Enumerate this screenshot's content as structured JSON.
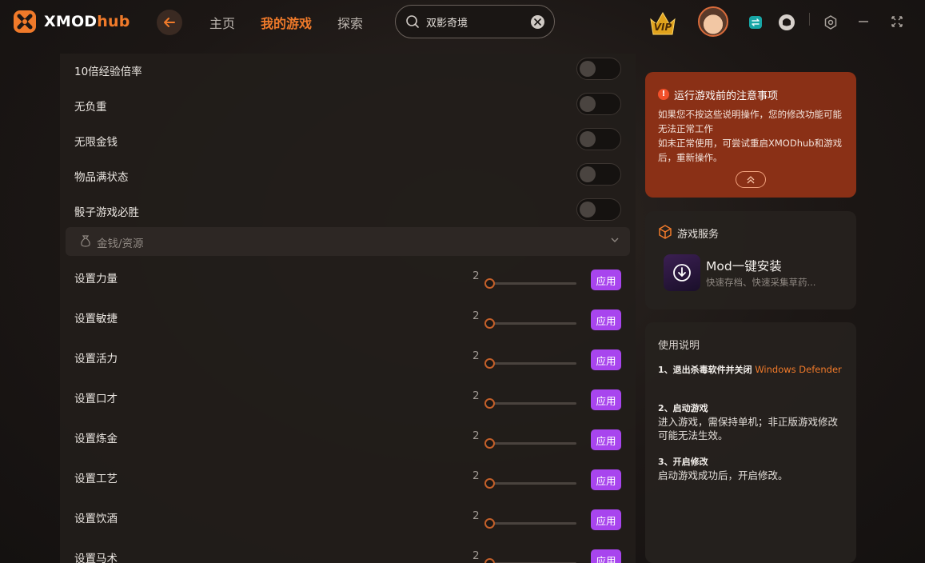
{
  "app": {
    "logo_prefix": "XMOD",
    "logo_suffix": "hub"
  },
  "nav": {
    "home": "主页",
    "my_games": "我的游戏",
    "explore": "探索"
  },
  "search": {
    "value": "双影奇境"
  },
  "vip": {
    "label": "VIP"
  },
  "toggles": [
    {
      "label": "10倍经验倍率",
      "on": false
    },
    {
      "label": "无负重",
      "on": false
    },
    {
      "label": "无限金钱",
      "on": false
    },
    {
      "label": "物品满状态",
      "on": false
    },
    {
      "label": "骰子游戏必胜",
      "on": false
    }
  ],
  "section": {
    "label": "金钱/资源"
  },
  "sliders": [
    {
      "label": "设置力量",
      "value": "2",
      "button": "应用"
    },
    {
      "label": "设置敏捷",
      "value": "2",
      "button": "应用"
    },
    {
      "label": "设置活力",
      "value": "2",
      "button": "应用"
    },
    {
      "label": "设置口才",
      "value": "2",
      "button": "应用"
    },
    {
      "label": "设置炼金",
      "value": "2",
      "button": "应用"
    },
    {
      "label": "设置工艺",
      "value": "2",
      "button": "应用"
    },
    {
      "label": "设置饮酒",
      "value": "2",
      "button": "应用"
    },
    {
      "label": "设置马术",
      "value": "2",
      "button": "应用"
    }
  ],
  "notice": {
    "title": "运行游戏前的注意事项",
    "line1": "如果您不按这些说明操作，您的修改功能可能无法正常工作",
    "line2": "如未正常使用，可尝试重启XMODhub和游戏后，重新操作。"
  },
  "service": {
    "title": "游戏服务",
    "mod_name": "Mod一键安装",
    "mod_sub": "快速存档、快速采集草药..."
  },
  "guide": {
    "title": "使用说明",
    "step1_head": "1、退出杀毒软件并关闭",
    "step1_highlight": "Windows Defender",
    "step2_head": "2、启动游戏",
    "step2_desc": "进入游戏，需保持单机；非正版游戏修改可能无法生效。",
    "step3_head": "3、开启修改",
    "step3_desc": "启动游戏成功后，开启修改。"
  },
  "colors": {
    "accent": "#f07a2a",
    "apply_button": "#a845ee",
    "notice_bg": "#8a3016"
  }
}
